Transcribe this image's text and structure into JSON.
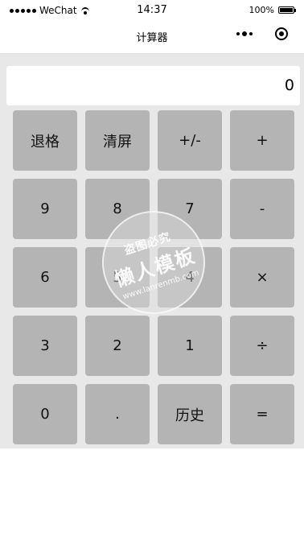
{
  "statusbar": {
    "carrier": "WeChat",
    "time": "14:37",
    "battery": "100%"
  },
  "navbar": {
    "title": "计算器",
    "more_icon": "more-dots-icon",
    "close_icon": "target-circle-icon"
  },
  "display": {
    "value": "0"
  },
  "keys": [
    {
      "label": "退格"
    },
    {
      "label": "清屏"
    },
    {
      "label": "+/-"
    },
    {
      "label": "+"
    },
    {
      "label": "9"
    },
    {
      "label": "8"
    },
    {
      "label": "7"
    },
    {
      "label": "-"
    },
    {
      "label": "6"
    },
    {
      "label": "5"
    },
    {
      "label": "4"
    },
    {
      "label": "×"
    },
    {
      "label": "3"
    },
    {
      "label": "2"
    },
    {
      "label": "1"
    },
    {
      "label": "÷"
    },
    {
      "label": "0"
    },
    {
      "label": "."
    },
    {
      "label": "历史"
    },
    {
      "label": "="
    }
  ],
  "watermark": {
    "line1": "盗图必究",
    "line2": "懒人模板",
    "line3": "www.lanrenmb.com"
  },
  "colors": {
    "key_bg": "#b4b4b4",
    "calc_bg": "#e8e8e8",
    "display_bg": "#ffffff"
  }
}
